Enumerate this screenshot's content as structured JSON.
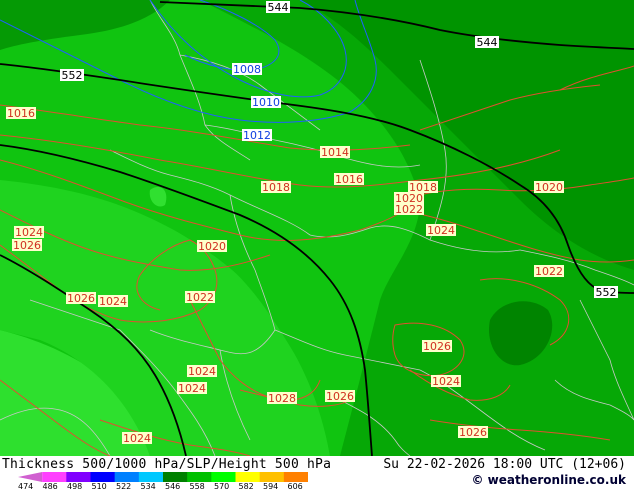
{
  "title": "Thickness 500/1000 hPa/SLP/Height 500 hPa",
  "datetime": "Su 22-02-2026 18:00 UTC (12+06)",
  "copyright": "© weatheronline.co.uk",
  "legend": {
    "labels": [
      "474",
      "486",
      "498",
      "510",
      "522",
      "534",
      "546",
      "558",
      "570",
      "582",
      "594",
      "606"
    ],
    "colors": [
      "#d060d0",
      "#ff40ff",
      "#8000ff",
      "#0000ff",
      "#0080ff",
      "#00c8ff",
      "#008000",
      "#00c000",
      "#00ff00",
      "#ffff00",
      "#ffc000",
      "#ff8000"
    ]
  },
  "colors": {
    "slp_isobar": "#e05030",
    "slp_low_isobar": "#2060ff",
    "geopotential": "#000000",
    "border": "#c8c8c8"
  },
  "geopotential_labels": [
    "544",
    "544",
    "552",
    "552"
  ],
  "slp_labels": [
    "1008",
    "1010",
    "1012",
    "1016",
    "1014",
    "1016",
    "1018",
    "1018",
    "1020",
    "1020",
    "1022",
    "1024",
    "1026",
    "1020",
    "1024",
    "1026",
    "1024",
    "1022",
    "1022",
    "1024",
    "1024",
    "1028",
    "1026",
    "1026",
    "1024",
    "1024",
    "1026"
  ]
}
